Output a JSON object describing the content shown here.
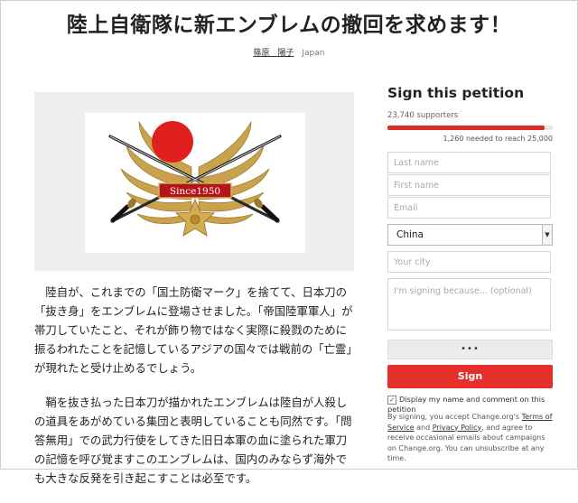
{
  "title": "陸上自衛隊に新エンブレムの撤回を求めます！",
  "author": {
    "name": "篠原　陽子",
    "country": "Japan"
  },
  "emblem": {
    "banner_text": "Since1950"
  },
  "body": {
    "paragraphs": [
      "陸自が、これまでの「国土防衛マーク」を捨てて、日本刀の「抜き身」をエンブレムに登場させました。「帝国陸軍軍人」が帯刀していたこと、それが飾り物ではなく実際に殺戮のために振るわれたことを記憶しているアジアの国々では戦前の「亡霊」が現れたと受け止めるでしょう。",
      "鞘を抜き払った日本刀が描かれたエンブレムは陸自が人殺しの道具をあがめている集団と表明していることも同然です。「問答無用」での武力行使をしてきた旧日本軍の血に塗られた軍刀の記憶を呼び覚ますこのエンブレムは、国内のみならず海外でも大きな反発を引き起こすことは必至です。"
    ]
  },
  "petition": {
    "heading": "Sign this petition",
    "supporters": "23,740 supporters",
    "progress": 0.95,
    "needed": "1,260 needed to reach 25,000",
    "first_name_placeholder": "Last name",
    "last_name_placeholder": "First name",
    "email_placeholder": "Email",
    "country": "China",
    "city_placeholder": "Your city",
    "comment_placeholder": "I'm signing because...  (optional)",
    "more_label": "•••",
    "sign_label": "Sign",
    "display_label": "Display my name and comment on this petition",
    "terms": {
      "prefix": "By signing, you accept Change.org's ",
      "tos": "Terms of Service",
      "and": " and ",
      "privacy": "Privacy Policy",
      "suffix": ", and agree to receive occasional emails about campaigns on Change.org. You can unsubscribe at any time."
    }
  },
  "colors": {
    "accent": "#e42f2a",
    "progress": "#dc2a27",
    "gold": "#c9a24a",
    "rising_sun": "#e11f1f"
  }
}
